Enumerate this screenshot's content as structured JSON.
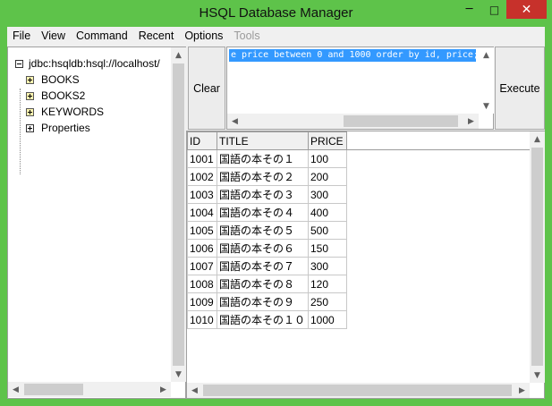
{
  "window": {
    "title": "HSQL Database Manager",
    "min_glyph": "─",
    "max_glyph": "□",
    "close_glyph": "✕"
  },
  "menu": {
    "items": [
      {
        "label": "File",
        "enabled": true
      },
      {
        "label": "View",
        "enabled": true
      },
      {
        "label": "Command",
        "enabled": true
      },
      {
        "label": "Recent",
        "enabled": true
      },
      {
        "label": "Options",
        "enabled": true
      },
      {
        "label": "Tools",
        "enabled": false
      }
    ]
  },
  "tree": {
    "root": "jdbc:hsqldb:hsql://localhost/",
    "items": [
      {
        "label": "BOOKS"
      },
      {
        "label": "BOOKS2"
      },
      {
        "label": "KEYWORDS"
      },
      {
        "label": "Properties"
      }
    ]
  },
  "query": {
    "text": "e price between 0 and 1000 order by id, price;"
  },
  "buttons": {
    "clear": "Clear",
    "execute": "Execute"
  },
  "results": {
    "columns": [
      "ID",
      "TITLE",
      "PRICE"
    ],
    "rows": [
      [
        "1001",
        "国語の本その１",
        "100"
      ],
      [
        "1002",
        "国語の本その２",
        "200"
      ],
      [
        "1003",
        "国語の本その３",
        "300"
      ],
      [
        "1004",
        "国語の本その４",
        "400"
      ],
      [
        "1005",
        "国語の本その５",
        "500"
      ],
      [
        "1006",
        "国語の本その６",
        "150"
      ],
      [
        "1007",
        "国語の本その７",
        "300"
      ],
      [
        "1008",
        "国語の本その８",
        "120"
      ],
      [
        "1009",
        "国語の本その９",
        "250"
      ],
      [
        "1010",
        "国語の本その１０",
        "1000"
      ]
    ]
  },
  "colors": {
    "titlebar": "#5ec34a",
    "close_button": "#c7312b",
    "selection": "#3399ff"
  },
  "icons": {
    "up": "▲",
    "down": "▼",
    "left": "◀",
    "right": "▶"
  }
}
